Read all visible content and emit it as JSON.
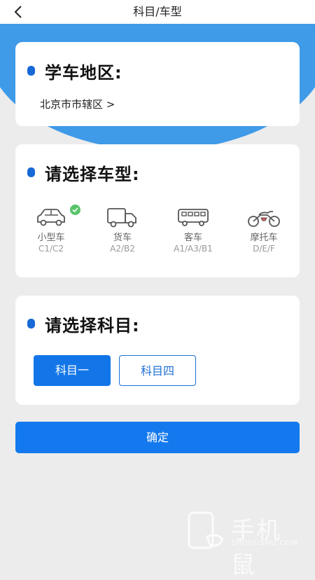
{
  "header": {
    "title": "科目/车型"
  },
  "region": {
    "title": "学车地区:",
    "value": "北京市市辖区",
    "chevron": ">"
  },
  "vehicle_section": {
    "title": "请选择车型:",
    "selected_index": 0,
    "items": [
      {
        "name": "小型车",
        "code": "C1/C2",
        "icon": "car-icon"
      },
      {
        "name": "货车",
        "code": "A2/B2",
        "icon": "truck-icon"
      },
      {
        "name": "客车",
        "code": "A1/A3/B1",
        "icon": "bus-icon"
      },
      {
        "name": "摩托车",
        "code": "D/E/F",
        "icon": "motorcycle-icon"
      }
    ]
  },
  "subject_section": {
    "title": "请选择科目:",
    "options": [
      {
        "label": "科目一",
        "selected": true
      },
      {
        "label": "科目四",
        "selected": false
      }
    ]
  },
  "confirm": {
    "label": "确定"
  },
  "watermark": {
    "brand": "手机鼠",
    "url": "SHOUJISHU.COM"
  },
  "colors": {
    "accent": "#1479ee",
    "banner": "#3f9ae8",
    "check": "#58c46a",
    "bullet": "#1769d6"
  }
}
